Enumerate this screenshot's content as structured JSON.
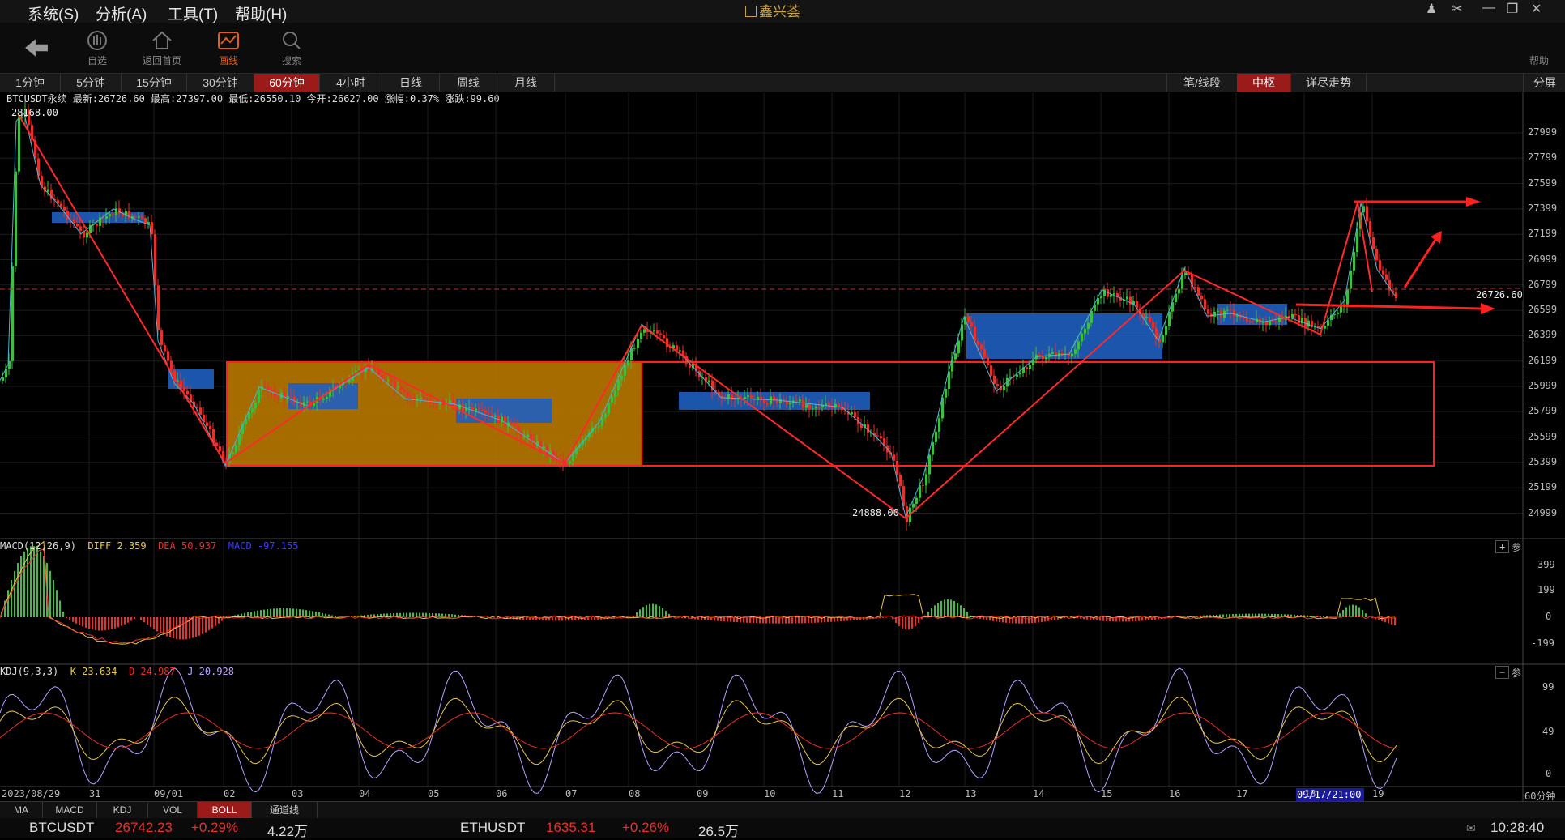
{
  "menu": {
    "items": [
      "系统(S)",
      "分析(A)",
      "工具(T)",
      "帮助(H)"
    ],
    "app_title": "鑫兴荟"
  },
  "toolbar": {
    "items": [
      {
        "label": "自选",
        "icon": "chart-bars-icon"
      },
      {
        "label": "返回首页",
        "icon": "home-icon"
      },
      {
        "label": "画线",
        "icon": "draw-line-icon"
      },
      {
        "label": "搜索",
        "icon": "search-icon"
      }
    ],
    "help": "帮助"
  },
  "periods": {
    "tabs": [
      "1分钟",
      "5分钟",
      "15分钟",
      "30分钟",
      "60分钟",
      "4小时",
      "日线",
      "周线",
      "月线"
    ],
    "active": "60分钟"
  },
  "right_tabs": {
    "tabs": [
      "笔/线段",
      "中枢",
      "详尽走势"
    ],
    "active": "中枢",
    "split": "分屏"
  },
  "info": {
    "line": "BTCUSDT永续  最新:26726.60 最高:27397.00 最低:26550.10 今开:26627.00 涨幅:0.37% 涨跌:99.60"
  },
  "main": {
    "high_label": "28168.00",
    "low_label": "24888.00",
    "last_price": "26726.60",
    "y_ticks": [
      "27999",
      "27799",
      "27599",
      "27399",
      "27199",
      "26999",
      "26799",
      "26599",
      "26399",
      "26199",
      "25999",
      "25799",
      "25599",
      "25399",
      "25199",
      "24999"
    ]
  },
  "macd": {
    "title": "MACD(12,26,9)",
    "diff": "DIFF 2.359",
    "dea": "DEA 50.937",
    "macd": "MACD -97.155",
    "y_ticks": [
      "399",
      "199",
      "0",
      "-199"
    ],
    "btn_plus": "+",
    "btn_param": "参"
  },
  "kdj": {
    "title": "KDJ(9,3,3)",
    "k": "K 23.634",
    "d": "D 24.987",
    "j": "J 20.928",
    "y_ticks": [
      "99",
      "49",
      "0"
    ],
    "btn_minus": "−",
    "btn_param": "参"
  },
  "x_axis": {
    "labels": [
      "2023/08/29",
      "31",
      "09/01",
      "02",
      "03",
      "04",
      "05",
      "06",
      "07",
      "08",
      "09",
      "10",
      "11",
      "12",
      "13",
      "14",
      "15",
      "16",
      "17",
      "18",
      "19"
    ],
    "cursor": "09/17/21:00",
    "period": "60分钟"
  },
  "indicators": {
    "tabs": [
      "MA",
      "MACD",
      "KDJ",
      "VOL",
      "BOLL",
      "通道线"
    ],
    "active": "BOLL"
  },
  "quotes": [
    {
      "symbol": "BTCUSDT",
      "price": "26742.23",
      "change": "+0.29%",
      "volume": "4.22万"
    },
    {
      "symbol": "ETHUSDT",
      "price": "1635.31",
      "change": "+0.26%",
      "volume": "26.5万"
    }
  ],
  "clock": "10:28:40",
  "colors": {
    "up": "#e8312a",
    "down": "#3fbf3f",
    "accent": "#9b1a1a",
    "zone_orange": "#b87800",
    "zone_blue": "#1f5fbf",
    "k": "#e6c84b",
    "d": "#e8312a",
    "j": "#b9a0ff"
  },
  "chart_data": {
    "type": "candlestick",
    "symbol": "BTCUSDT永续",
    "period": "60分钟",
    "ylim": [
      24888,
      28168
    ],
    "pivots": [
      {
        "label": "28168.00",
        "value": 28168
      },
      {
        "label": "24888.00",
        "value": 24888
      }
    ],
    "last": 26726.6,
    "open": 26627,
    "high": 27397,
    "low": 26550.1
  }
}
